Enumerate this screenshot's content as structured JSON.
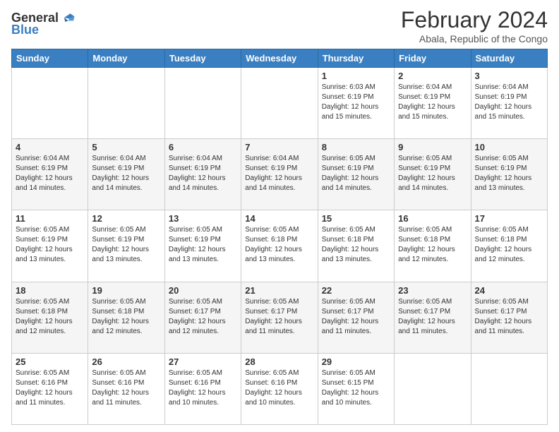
{
  "header": {
    "logo_general": "General",
    "logo_blue": "Blue",
    "title": "February 2024",
    "location": "Abala, Republic of the Congo"
  },
  "days_of_week": [
    "Sunday",
    "Monday",
    "Tuesday",
    "Wednesday",
    "Thursday",
    "Friday",
    "Saturday"
  ],
  "weeks": [
    [
      {
        "day": "",
        "info": ""
      },
      {
        "day": "",
        "info": ""
      },
      {
        "day": "",
        "info": ""
      },
      {
        "day": "",
        "info": ""
      },
      {
        "day": "1",
        "info": "Sunrise: 6:03 AM\nSunset: 6:19 PM\nDaylight: 12 hours and 15 minutes."
      },
      {
        "day": "2",
        "info": "Sunrise: 6:04 AM\nSunset: 6:19 PM\nDaylight: 12 hours and 15 minutes."
      },
      {
        "day": "3",
        "info": "Sunrise: 6:04 AM\nSunset: 6:19 PM\nDaylight: 12 hours and 15 minutes."
      }
    ],
    [
      {
        "day": "4",
        "info": "Sunrise: 6:04 AM\nSunset: 6:19 PM\nDaylight: 12 hours and 14 minutes."
      },
      {
        "day": "5",
        "info": "Sunrise: 6:04 AM\nSunset: 6:19 PM\nDaylight: 12 hours and 14 minutes."
      },
      {
        "day": "6",
        "info": "Sunrise: 6:04 AM\nSunset: 6:19 PM\nDaylight: 12 hours and 14 minutes."
      },
      {
        "day": "7",
        "info": "Sunrise: 6:04 AM\nSunset: 6:19 PM\nDaylight: 12 hours and 14 minutes."
      },
      {
        "day": "8",
        "info": "Sunrise: 6:05 AM\nSunset: 6:19 PM\nDaylight: 12 hours and 14 minutes."
      },
      {
        "day": "9",
        "info": "Sunrise: 6:05 AM\nSunset: 6:19 PM\nDaylight: 12 hours and 14 minutes."
      },
      {
        "day": "10",
        "info": "Sunrise: 6:05 AM\nSunset: 6:19 PM\nDaylight: 12 hours and 13 minutes."
      }
    ],
    [
      {
        "day": "11",
        "info": "Sunrise: 6:05 AM\nSunset: 6:19 PM\nDaylight: 12 hours and 13 minutes."
      },
      {
        "day": "12",
        "info": "Sunrise: 6:05 AM\nSunset: 6:19 PM\nDaylight: 12 hours and 13 minutes."
      },
      {
        "day": "13",
        "info": "Sunrise: 6:05 AM\nSunset: 6:19 PM\nDaylight: 12 hours and 13 minutes."
      },
      {
        "day": "14",
        "info": "Sunrise: 6:05 AM\nSunset: 6:18 PM\nDaylight: 12 hours and 13 minutes."
      },
      {
        "day": "15",
        "info": "Sunrise: 6:05 AM\nSunset: 6:18 PM\nDaylight: 12 hours and 13 minutes."
      },
      {
        "day": "16",
        "info": "Sunrise: 6:05 AM\nSunset: 6:18 PM\nDaylight: 12 hours and 12 minutes."
      },
      {
        "day": "17",
        "info": "Sunrise: 6:05 AM\nSunset: 6:18 PM\nDaylight: 12 hours and 12 minutes."
      }
    ],
    [
      {
        "day": "18",
        "info": "Sunrise: 6:05 AM\nSunset: 6:18 PM\nDaylight: 12 hours and 12 minutes."
      },
      {
        "day": "19",
        "info": "Sunrise: 6:05 AM\nSunset: 6:18 PM\nDaylight: 12 hours and 12 minutes."
      },
      {
        "day": "20",
        "info": "Sunrise: 6:05 AM\nSunset: 6:17 PM\nDaylight: 12 hours and 12 minutes."
      },
      {
        "day": "21",
        "info": "Sunrise: 6:05 AM\nSunset: 6:17 PM\nDaylight: 12 hours and 11 minutes."
      },
      {
        "day": "22",
        "info": "Sunrise: 6:05 AM\nSunset: 6:17 PM\nDaylight: 12 hours and 11 minutes."
      },
      {
        "day": "23",
        "info": "Sunrise: 6:05 AM\nSunset: 6:17 PM\nDaylight: 12 hours and 11 minutes."
      },
      {
        "day": "24",
        "info": "Sunrise: 6:05 AM\nSunset: 6:17 PM\nDaylight: 12 hours and 11 minutes."
      }
    ],
    [
      {
        "day": "25",
        "info": "Sunrise: 6:05 AM\nSunset: 6:16 PM\nDaylight: 12 hours and 11 minutes."
      },
      {
        "day": "26",
        "info": "Sunrise: 6:05 AM\nSunset: 6:16 PM\nDaylight: 12 hours and 11 minutes."
      },
      {
        "day": "27",
        "info": "Sunrise: 6:05 AM\nSunset: 6:16 PM\nDaylight: 12 hours and 10 minutes."
      },
      {
        "day": "28",
        "info": "Sunrise: 6:05 AM\nSunset: 6:16 PM\nDaylight: 12 hours and 10 minutes."
      },
      {
        "day": "29",
        "info": "Sunrise: 6:05 AM\nSunset: 6:15 PM\nDaylight: 12 hours and 10 minutes."
      },
      {
        "day": "",
        "info": ""
      },
      {
        "day": "",
        "info": ""
      }
    ]
  ]
}
